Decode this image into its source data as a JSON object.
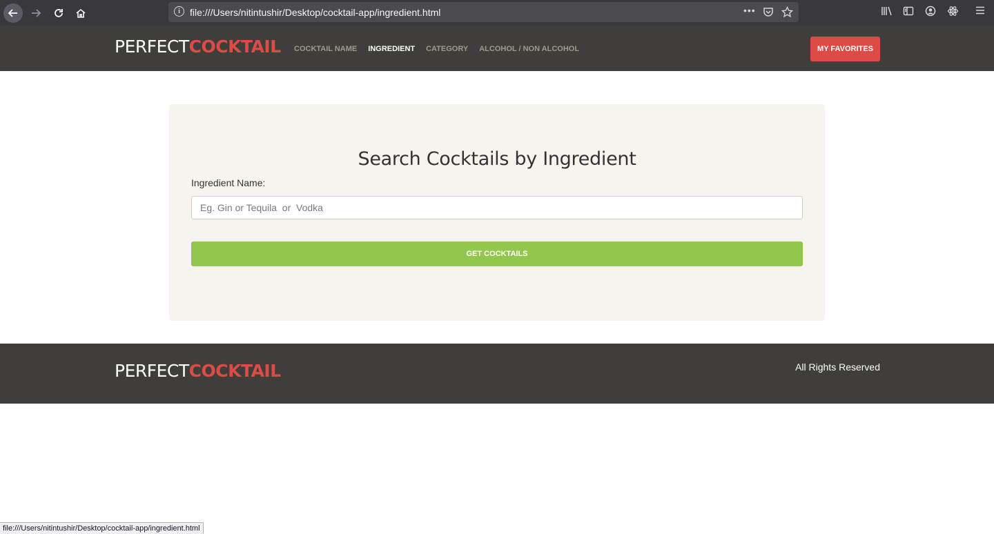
{
  "browser": {
    "url": "file:///Users/nitintushir/Desktop/cocktail-app/ingredient.html",
    "status_url": "file:///Users/nitintushir/Desktop/cocktail-app/ingredient.html"
  },
  "header": {
    "brand_part1": "PERFECT",
    "brand_part2": "COCKTAIL",
    "nav": [
      {
        "label": "COCKTAIL NAME",
        "active": false
      },
      {
        "label": "INGREDIENT",
        "active": true
      },
      {
        "label": "CATEGORY",
        "active": false
      },
      {
        "label": "ALCOHOL / NON ALCOHOL",
        "active": false
      }
    ],
    "favorites_label": "MY FAVORITES"
  },
  "search": {
    "title": "Search Cocktails by Ingredient",
    "label": "Ingredient Name:",
    "placeholder": "Eg. Gin or Tequila  or  Vodka",
    "value": "",
    "button_label": "GET COCKTAILS"
  },
  "footer": {
    "brand_part1": "PERFECT",
    "brand_part2": "COCKTAIL",
    "rights": "All Rights Reserved"
  },
  "colors": {
    "header_bg": "#3f3e3a",
    "accent_red": "#dd4b47",
    "accent_green": "#93c64c",
    "card_bg": "#f7f4ef"
  }
}
